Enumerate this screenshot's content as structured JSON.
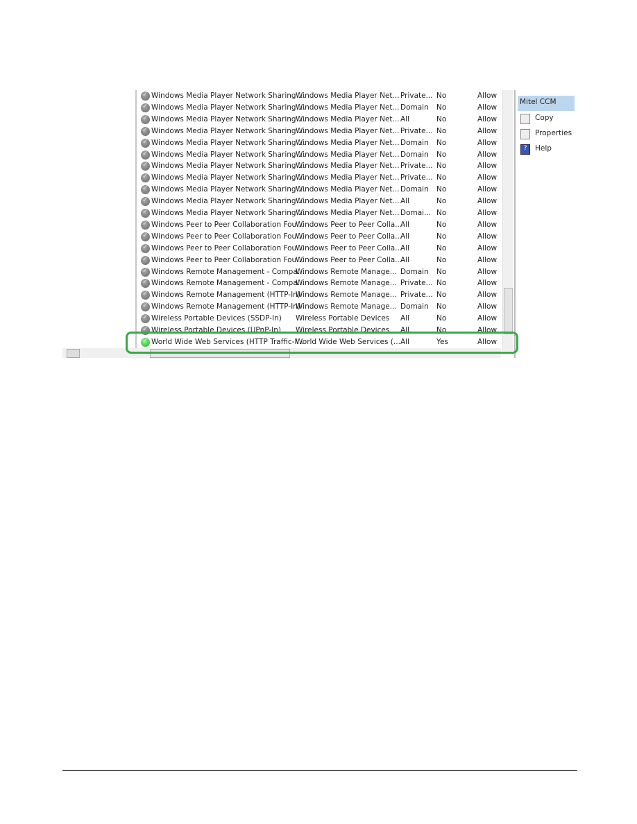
{
  "rules": [
    {
      "name": "Windows Media Player Network Sharing ...",
      "group": "Windows Media Player Net...",
      "profile": "Private...",
      "enabled": "No",
      "action": "Allow"
    },
    {
      "name": "Windows Media Player Network Sharing ...",
      "group": "Windows Media Player Net...",
      "profile": "Domain",
      "enabled": "No",
      "action": "Allow"
    },
    {
      "name": "Windows Media Player Network Sharing ...",
      "group": "Windows Media Player Net...",
      "profile": "All",
      "enabled": "No",
      "action": "Allow"
    },
    {
      "name": "Windows Media Player Network Sharing ...",
      "group": "Windows Media Player Net...",
      "profile": "Private...",
      "enabled": "No",
      "action": "Allow"
    },
    {
      "name": "Windows Media Player Network Sharing ...",
      "group": "Windows Media Player Net...",
      "profile": "Domain",
      "enabled": "No",
      "action": "Allow"
    },
    {
      "name": "Windows Media Player Network Sharing ...",
      "group": "Windows Media Player Net...",
      "profile": "Domain",
      "enabled": "No",
      "action": "Allow"
    },
    {
      "name": "Windows Media Player Network Sharing ...",
      "group": "Windows Media Player Net...",
      "profile": "Private...",
      "enabled": "No",
      "action": "Allow"
    },
    {
      "name": "Windows Media Player Network Sharing ...",
      "group": "Windows Media Player Net...",
      "profile": "Private...",
      "enabled": "No",
      "action": "Allow"
    },
    {
      "name": "Windows Media Player Network Sharing ...",
      "group": "Windows Media Player Net...",
      "profile": "Domain",
      "enabled": "No",
      "action": "Allow"
    },
    {
      "name": "Windows Media Player Network Sharing ...",
      "group": "Windows Media Player Net...",
      "profile": "All",
      "enabled": "No",
      "action": "Allow"
    },
    {
      "name": "Windows Media Player Network Sharing ...",
      "group": "Windows Media Player Net...",
      "profile": "Domai...",
      "enabled": "No",
      "action": "Allow"
    },
    {
      "name": "Windows Peer to Peer Collaboration Fou...",
      "group": "Windows Peer to Peer Colla...",
      "profile": "All",
      "enabled": "No",
      "action": "Allow"
    },
    {
      "name": "Windows Peer to Peer Collaboration Fou...",
      "group": "Windows Peer to Peer Colla...",
      "profile": "All",
      "enabled": "No",
      "action": "Allow"
    },
    {
      "name": "Windows Peer to Peer Collaboration Fou...",
      "group": "Windows Peer to Peer Colla...",
      "profile": "All",
      "enabled": "No",
      "action": "Allow"
    },
    {
      "name": "Windows Peer to Peer Collaboration Fou...",
      "group": "Windows Peer to Peer Colla...",
      "profile": "All",
      "enabled": "No",
      "action": "Allow"
    },
    {
      "name": "Windows Remote Management - Compa...",
      "group": "Windows Remote Manage...",
      "profile": "Domain",
      "enabled": "No",
      "action": "Allow"
    },
    {
      "name": "Windows Remote Management - Compa...",
      "group": "Windows Remote Manage...",
      "profile": "Private...",
      "enabled": "No",
      "action": "Allow"
    },
    {
      "name": "Windows Remote Management (HTTP-In)",
      "group": "Windows Remote Manage...",
      "profile": "Private...",
      "enabled": "No",
      "action": "Allow"
    },
    {
      "name": "Windows Remote Management (HTTP-In)",
      "group": "Windows Remote Manage...",
      "profile": "Domain",
      "enabled": "No",
      "action": "Allow"
    },
    {
      "name": "Wireless Portable Devices (SSDP-In)",
      "group": "Wireless Portable Devices",
      "profile": "All",
      "enabled": "No",
      "action": "Allow"
    },
    {
      "name": "Wireless Portable Devices (UPnP-In)",
      "group": "Wireless Portable Devices",
      "profile": "All",
      "enabled": "No",
      "action": "Allow"
    },
    {
      "name": "World Wide Web Services (HTTP Traffic-I...",
      "group": "World Wide Web Services (...",
      "profile": "All",
      "enabled": "Yes",
      "action": "Allow",
      "highlighted": true
    }
  ],
  "actions": {
    "title": "Mitel CCM",
    "items": [
      {
        "label": "Copy",
        "icon": "copy-icon"
      },
      {
        "label": "Properties",
        "icon": "properties-icon"
      },
      {
        "label": "Help",
        "icon": "help-icon"
      }
    ]
  },
  "colors": {
    "highlight": "#3aa84a",
    "enabled_icon": "#2a2",
    "panel_title": "#bcd6ee"
  }
}
